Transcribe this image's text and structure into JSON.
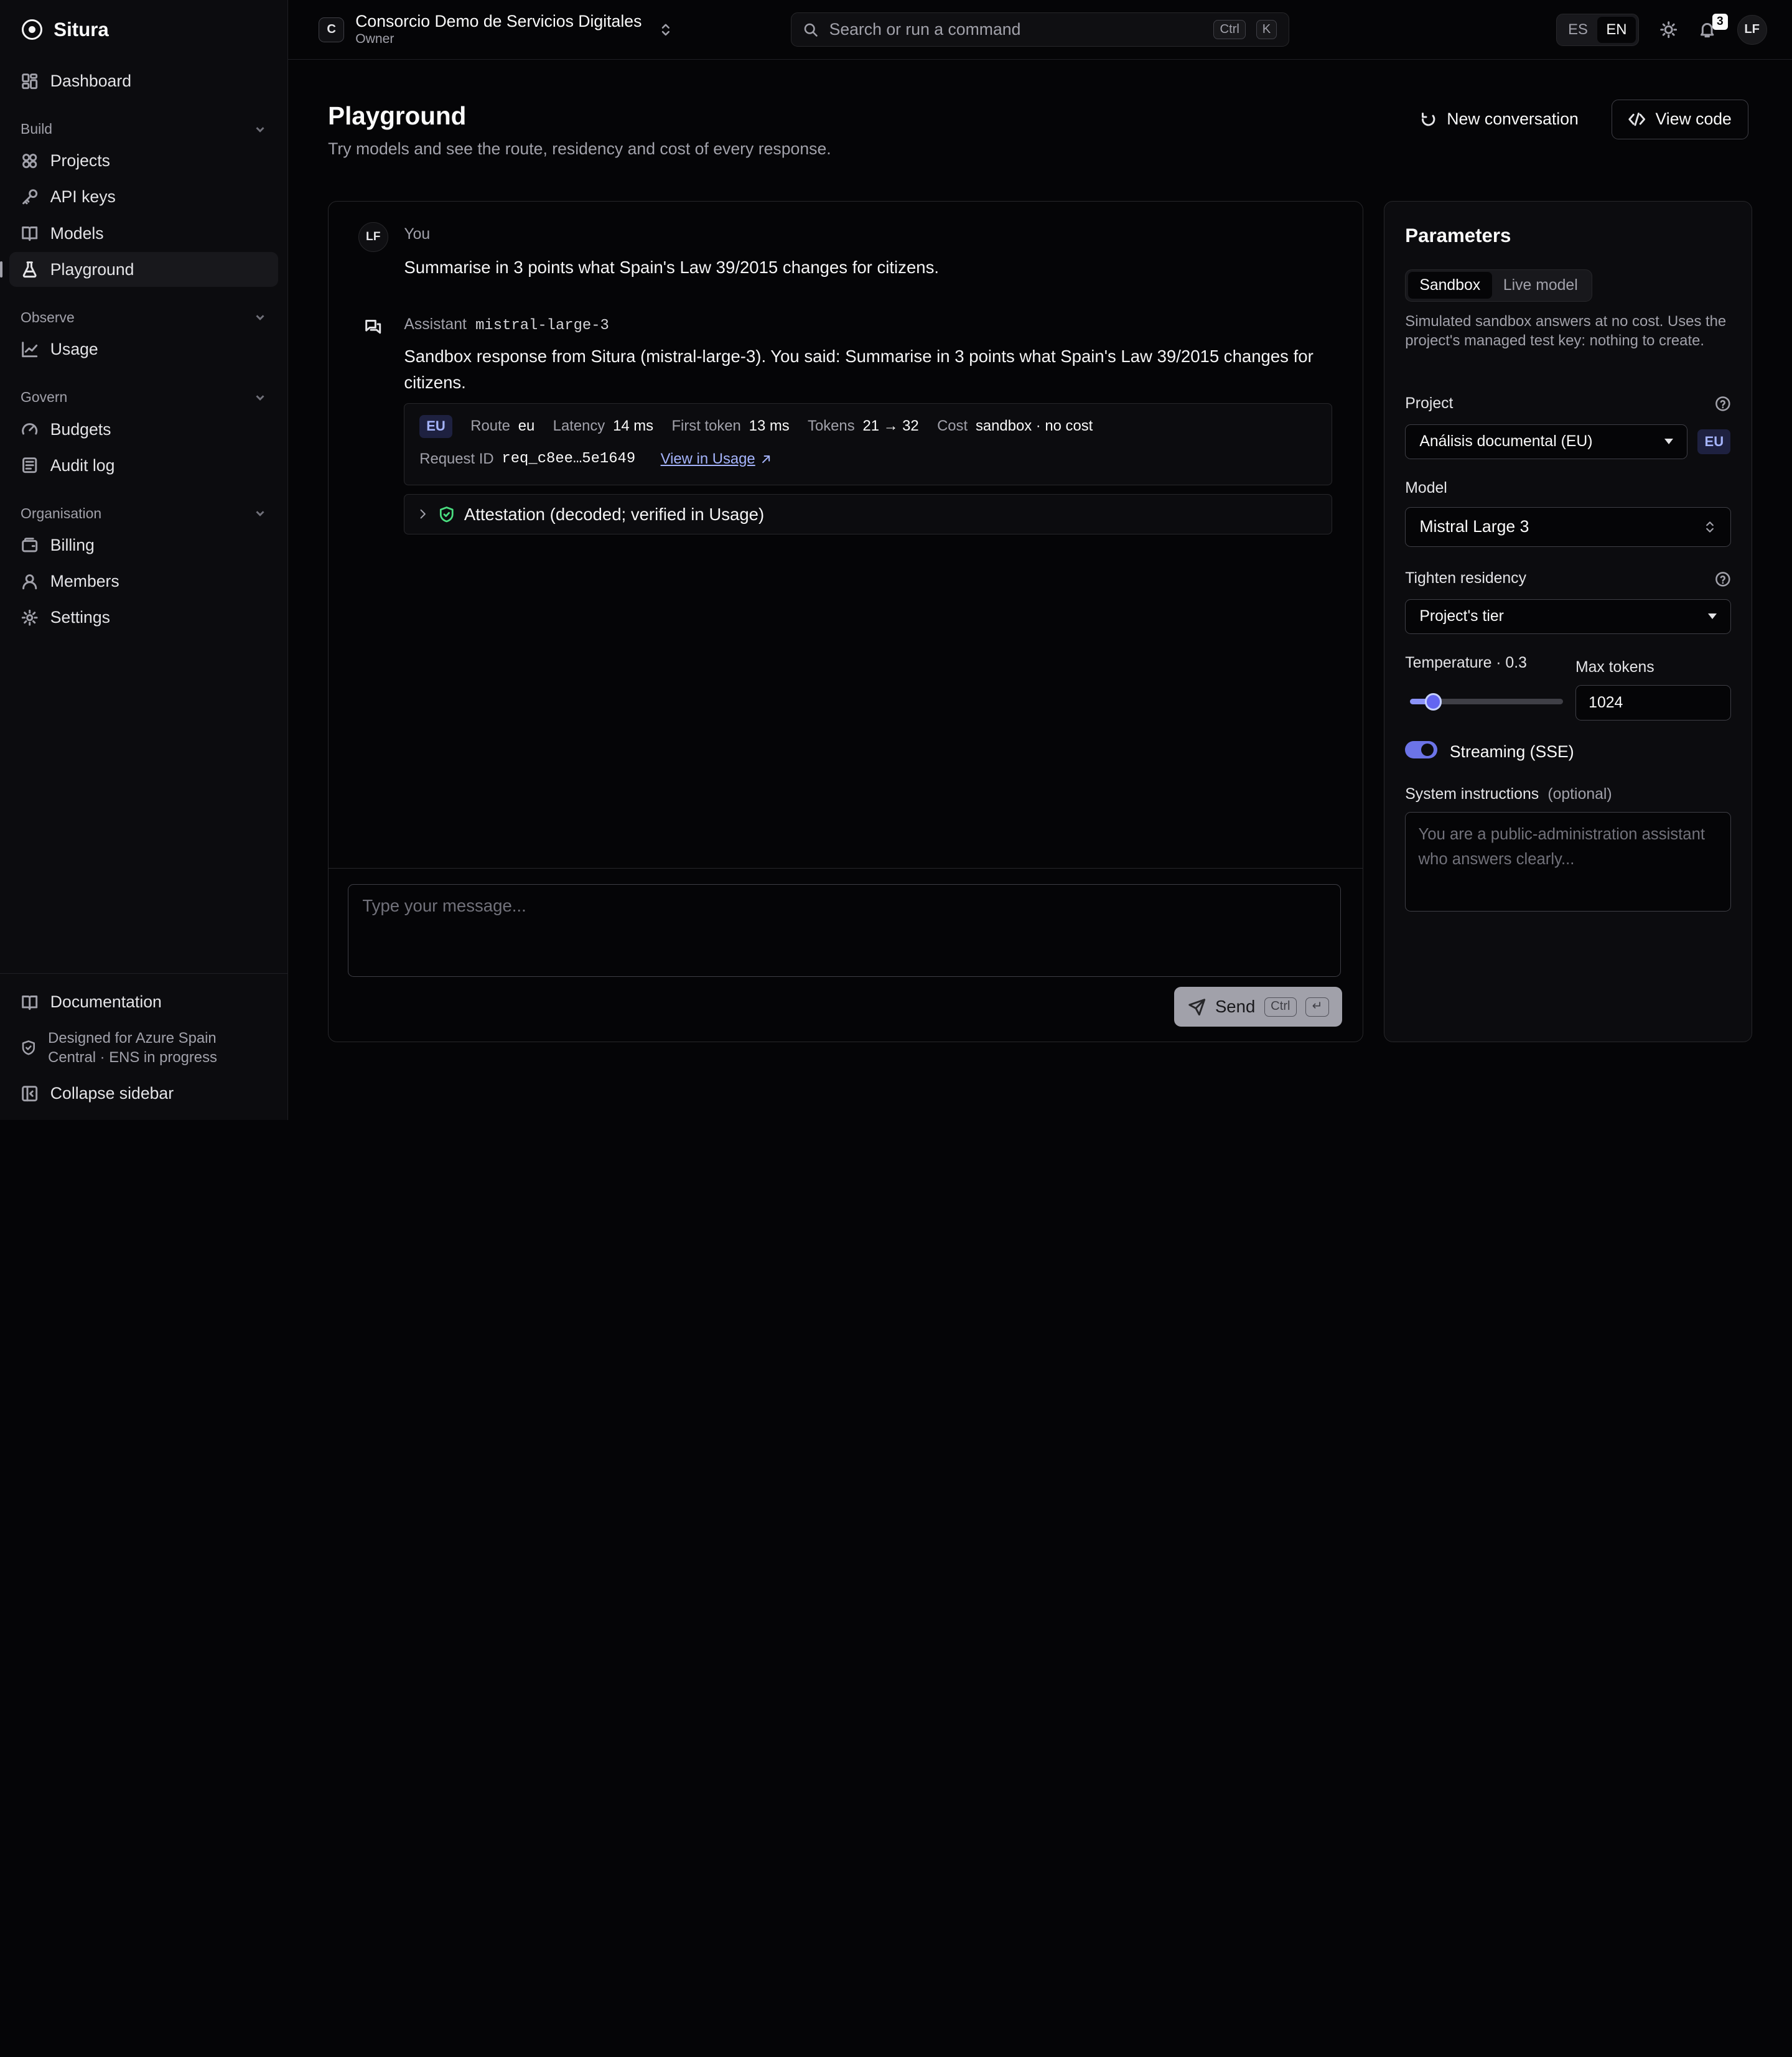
{
  "brand": {
    "name": "Situra"
  },
  "sidebar": {
    "dashboard": "Dashboard",
    "groups": {
      "build": "Build",
      "observe": "Observe",
      "govern": "Govern",
      "organisation": "Organisation"
    },
    "items": {
      "projects": "Projects",
      "api_keys": "API keys",
      "models": "Models",
      "playground": "Playground",
      "usage": "Usage",
      "budgets": "Budgets",
      "audit_log": "Audit log",
      "billing": "Billing",
      "members": "Members",
      "settings": "Settings"
    },
    "bottom": {
      "documentation": "Documentation",
      "compliance_note": "Designed for Azure Spain Central · ENS in progress",
      "collapse": "Collapse sidebar"
    }
  },
  "topbar": {
    "org_initial": "C",
    "org_name": "Consorcio Demo de Servicios Digitales",
    "org_role": "Owner",
    "search_placeholder": "Search or run a command",
    "shortcut_ctrl": "Ctrl",
    "shortcut_key": "K",
    "lang_es": "ES",
    "lang_en": "EN",
    "active_lang": "EN",
    "notification_count": "3",
    "user_initials": "LF"
  },
  "page": {
    "title": "Playground",
    "subtitle": "Try models and see the route, residency and cost of every response.",
    "new_conversation": "New conversation",
    "view_code": "View code"
  },
  "conversation": {
    "user": {
      "initials": "LF",
      "role": "You",
      "text": "Summarise in 3 points what Spain's Law 39/2015 changes for citizens."
    },
    "assistant": {
      "role": "Assistant",
      "model": "mistral-large-3",
      "text": "Sandbox response from Situra (mistral-large-3). You said: Summarise in 3 points what Spain's Law 39/2015 changes for citizens."
    },
    "meta": {
      "region_badge": "EU",
      "route_label": "Route",
      "route_value": "eu",
      "latency_label": "Latency",
      "latency_value": "14 ms",
      "first_token_label": "First token",
      "first_token_value": "13 ms",
      "tokens_label": "Tokens",
      "tokens_value": "21 → 32",
      "cost_label": "Cost",
      "cost_value": "sandbox · no cost",
      "request_id_label": "Request ID",
      "request_id_value": "req_c8ee…5e1649",
      "view_in_usage": "View in Usage"
    },
    "attestation": "Attestation (decoded; verified in Usage)",
    "composer_placeholder": "Type your message...",
    "send_label": "Send",
    "send_shortcut": "Ctrl",
    "send_key": "↵"
  },
  "parameters": {
    "title": "Parameters",
    "mode_sandbox": "Sandbox",
    "mode_live": "Live model",
    "active_mode": "Sandbox",
    "mode_note": "Simulated sandbox answers at no cost. Uses the project's managed test key: nothing to create.",
    "project_label": "Project",
    "project_value": "Análisis documental (EU)",
    "project_region": "EU",
    "model_label": "Model",
    "model_value": "Mistral Large 3",
    "residency_label": "Tighten residency",
    "residency_value": "Project's tier",
    "temperature_label": "Temperature · 0.3",
    "temperature": 0.3,
    "max_tokens_label": "Max tokens",
    "max_tokens_value": "1024",
    "streaming_label": "Streaming (SSE)",
    "streaming_on": true,
    "system_label": "System instructions",
    "system_optional": "(optional)",
    "system_placeholder": "You are a public-administration assistant who answers clearly..."
  },
  "colors": {
    "background": "#050507",
    "sidebar": "#0c0c0f",
    "accent": "#6366f1",
    "region_badge_bg": "#1e2140",
    "region_badge_fg": "#a5b4fc"
  }
}
